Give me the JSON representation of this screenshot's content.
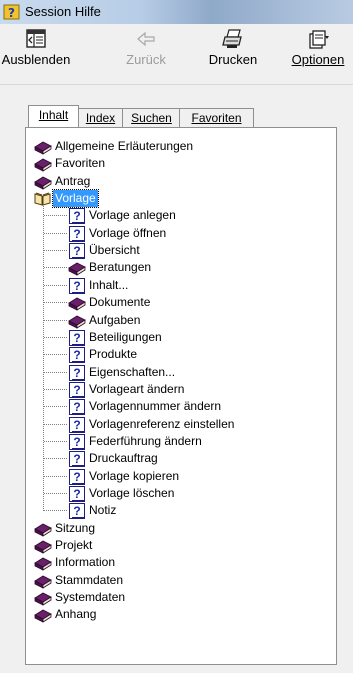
{
  "window": {
    "title": "Session Hilfe"
  },
  "toolbar": {
    "hide": {
      "label": "Ausblenden",
      "icon": "hide-pane-icon"
    },
    "back": {
      "label": "Zurück",
      "icon": "back-arrow-icon"
    },
    "print": {
      "label": "Drucken",
      "icon": "printer-icon"
    },
    "options": {
      "label": "Optionen",
      "icon": "options-icon"
    }
  },
  "tabs": [
    {
      "label": "Inhalt",
      "active": true
    },
    {
      "label": "Index",
      "active": false
    },
    {
      "label": "Suchen",
      "active": false
    },
    {
      "label": "Favoriten",
      "active": false
    }
  ],
  "tree": {
    "items": [
      {
        "label": "Allgemeine Erläuterungen",
        "icon": "book-closed-icon",
        "level": 0
      },
      {
        "label": "Favoriten",
        "icon": "book-closed-icon",
        "level": 0
      },
      {
        "label": "Antrag",
        "icon": "book-closed-icon",
        "level": 0
      },
      {
        "label": "Vorlage",
        "icon": "book-open-icon",
        "level": 0,
        "selected": true
      },
      {
        "label": "Vorlage anlegen",
        "icon": "help-topic-icon",
        "level": 1
      },
      {
        "label": "Vorlage öffnen",
        "icon": "help-topic-icon",
        "level": 1
      },
      {
        "label": "Übersicht",
        "icon": "help-topic-icon",
        "level": 1
      },
      {
        "label": "Beratungen",
        "icon": "book-closed-icon",
        "level": 1
      },
      {
        "label": "Inhalt...",
        "icon": "help-topic-icon",
        "level": 1
      },
      {
        "label": "Dokumente",
        "icon": "book-closed-icon",
        "level": 1
      },
      {
        "label": "Aufgaben",
        "icon": "book-closed-icon",
        "level": 1
      },
      {
        "label": "Beteiligungen",
        "icon": "help-topic-icon",
        "level": 1
      },
      {
        "label": "Produkte",
        "icon": "help-topic-icon",
        "level": 1
      },
      {
        "label": "Eigenschaften...",
        "icon": "help-topic-icon",
        "level": 1
      },
      {
        "label": "Vorlageart ändern",
        "icon": "help-topic-icon",
        "level": 1
      },
      {
        "label": "Vorlagennummer ändern",
        "icon": "help-topic-icon",
        "level": 1
      },
      {
        "label": "Vorlagenreferenz einstellen",
        "icon": "help-topic-icon",
        "level": 1
      },
      {
        "label": "Federführung ändern",
        "icon": "help-topic-icon",
        "level": 1
      },
      {
        "label": "Druckauftrag",
        "icon": "help-topic-icon",
        "level": 1
      },
      {
        "label": "Vorlage kopieren",
        "icon": "help-topic-icon",
        "level": 1
      },
      {
        "label": "Vorlage löschen",
        "icon": "help-topic-icon",
        "level": 1
      },
      {
        "label": "Notiz",
        "icon": "help-topic-icon",
        "level": 1
      },
      {
        "label": "Sitzung",
        "icon": "book-closed-icon",
        "level": 0
      },
      {
        "label": "Projekt",
        "icon": "book-closed-icon",
        "level": 0
      },
      {
        "label": "Information",
        "icon": "book-closed-icon",
        "level": 0
      },
      {
        "label": "Stammdaten",
        "icon": "book-closed-icon",
        "level": 0
      },
      {
        "label": "Systemdaten",
        "icon": "book-closed-icon",
        "level": 0
      },
      {
        "label": "Anhang",
        "icon": "book-closed-icon",
        "level": 0
      }
    ]
  },
  "colors": {
    "selection": "#3399ff",
    "book": "#6a1f6a",
    "help": "#1a2aa8"
  }
}
